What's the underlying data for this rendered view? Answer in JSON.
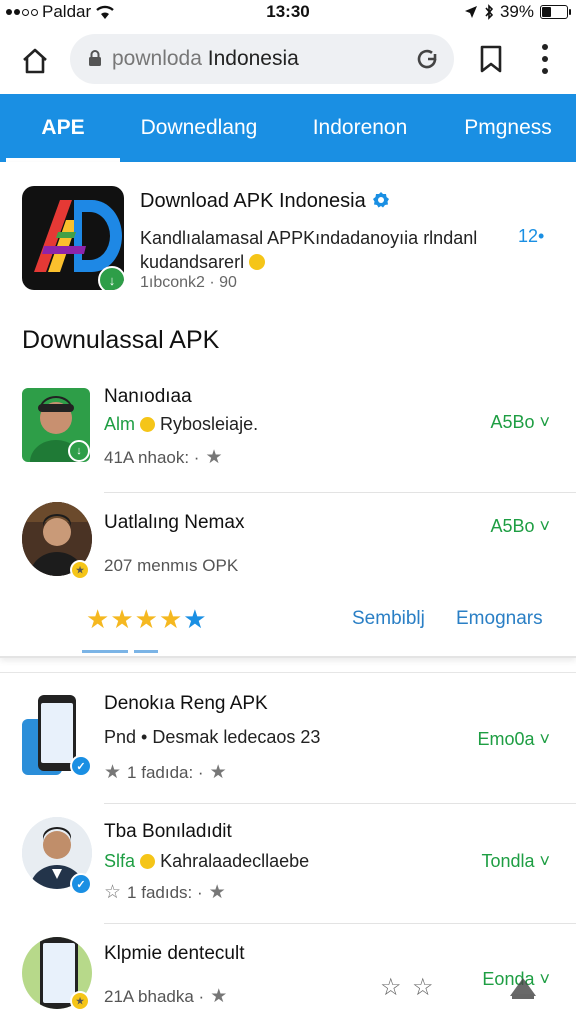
{
  "status_bar": {
    "carrier": "Paldar",
    "time": "13:30",
    "battery": "39%",
    "battery_level": 0.39
  },
  "address_bar": {
    "url_prefix": "pownloda",
    "url_main": "Indonesia",
    "icons": [
      "home-icon",
      "lock-icon",
      "reload-icon",
      "bookmark-icon",
      "more-icon"
    ]
  },
  "tabs": [
    {
      "label": "APE",
      "active": true
    },
    {
      "label": "Downedlang",
      "active": false
    },
    {
      "label": "Indorenon",
      "active": false
    },
    {
      "label": "Pmgness",
      "active": false
    }
  ],
  "header_app": {
    "title": "Download APK Indonesia",
    "description_line1": "Kandlıalamasal APPKındadanoyıia rlndanl",
    "description_line2": "kudandsarerl",
    "meta": "1ıbconk2 · 90",
    "count": "12•"
  },
  "section": {
    "title": "Downulassal APK"
  },
  "list_top": [
    {
      "name": "Nanıodıaa",
      "sub_green": "Alm",
      "sub_rest": "Rybosleiaje.",
      "meta": "41A nhaok: ·",
      "action": "A5Bo"
    },
    {
      "name": "Uatlalıng Nemax",
      "meta": "207 menmıs OPK",
      "action": "A5Bo"
    }
  ],
  "rating": {
    "stars": 4,
    "link1": "Sembiblj",
    "link2": "Emognars"
  },
  "list_bottom": [
    {
      "name": "Denokıa Reng APK",
      "sub_rest": "Pnd • Desmak ledecaos 23",
      "meta": "1 fadıda: ·",
      "action": "Emo0a"
    },
    {
      "name": "Tba Bonıladıdit",
      "sub_green": "Slfa",
      "sub_rest": "Kahralaadecllaebe",
      "meta": "1 fadıds: ·",
      "action": "Tondla"
    },
    {
      "name": "Klpmie dentecult",
      "meta": "21A bhadka ·",
      "action": "Eonda"
    }
  ],
  "colors": {
    "tab_bar": "#1a8fe3",
    "accent_green": "#1e9e43",
    "link_blue": "#2a7fc5",
    "star_gold": "#f5b820",
    "star_blue": "#1a8fe3"
  }
}
